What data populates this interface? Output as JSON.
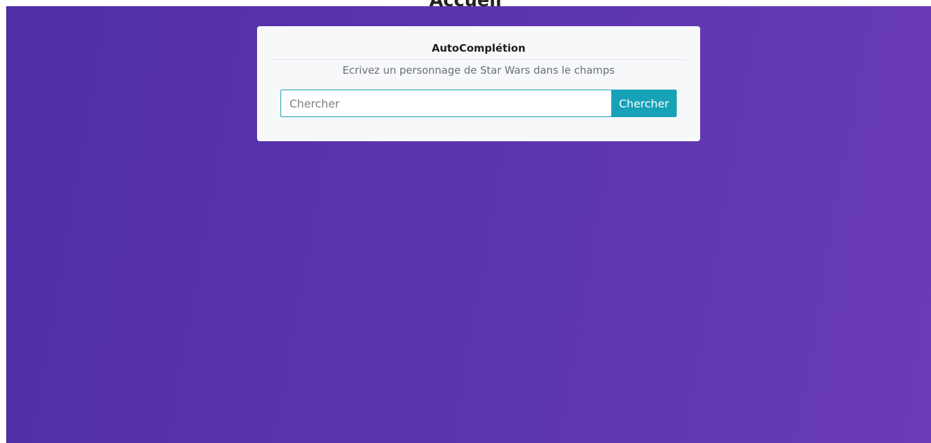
{
  "page": {
    "title": "Accueil"
  },
  "card": {
    "title": "AutoComplétion",
    "subtitle": "Ecrivez un personnage de Star Wars dans le champs"
  },
  "search": {
    "value": "",
    "placeholder": "Chercher",
    "button_label": "Chercher"
  },
  "colors": {
    "accent": "#17a2b8",
    "background_start": "#4f2ea6",
    "background_end": "#6a3bb6",
    "card_background": "#f7f8fa"
  }
}
